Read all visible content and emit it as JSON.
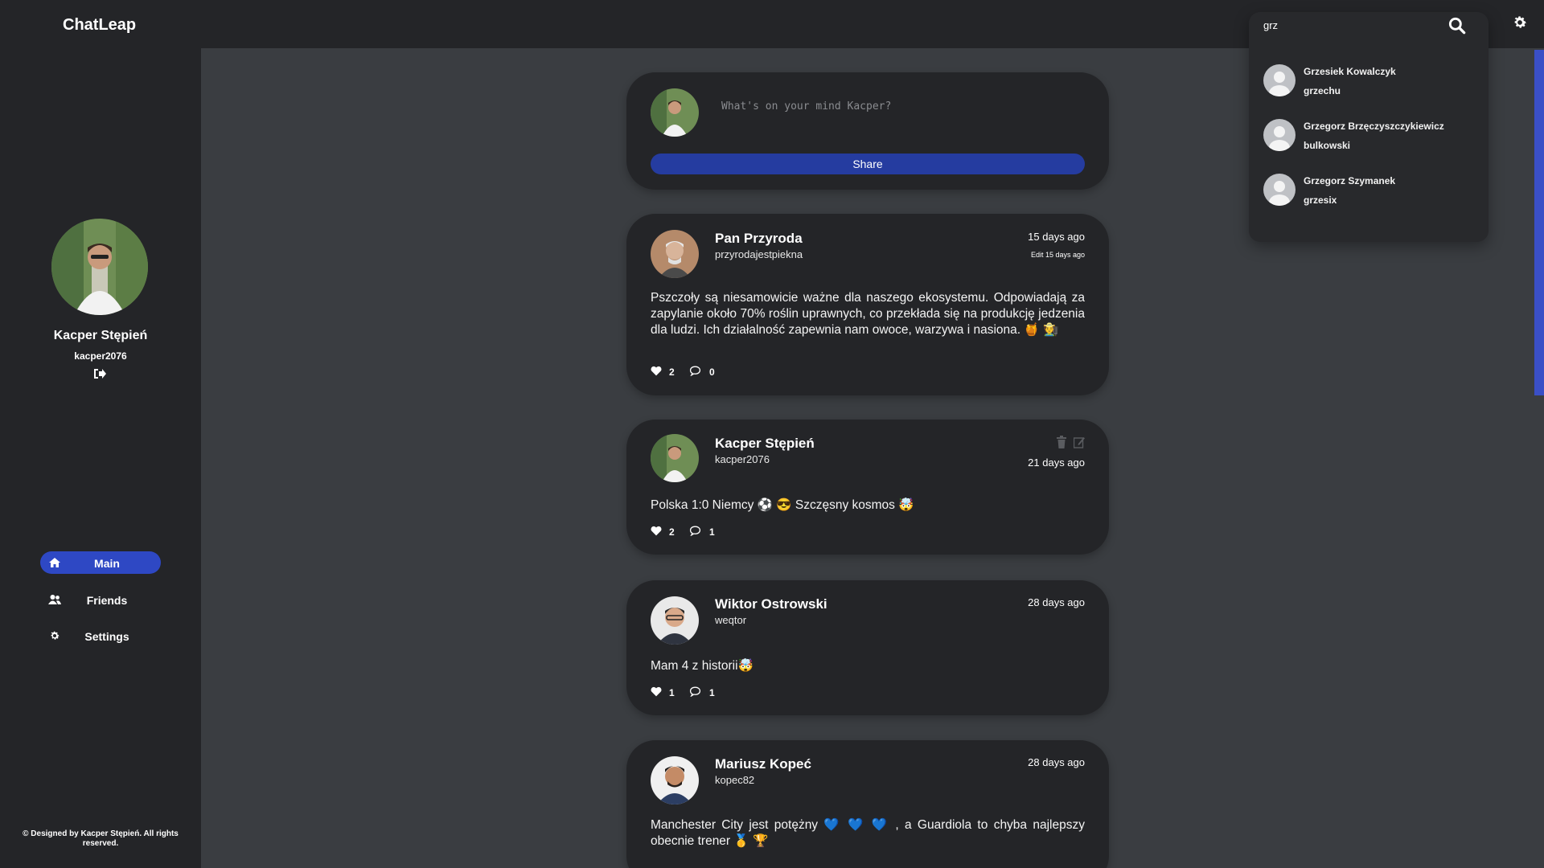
{
  "app": {
    "name": "ChatLeap"
  },
  "search": {
    "value": "grz"
  },
  "search_results": [
    {
      "name": "Grzesiek Kowalczyk",
      "handle": "grzechu"
    },
    {
      "name": "Grzegorz Brzęczyszczykiewicz",
      "handle": "bulkowski"
    },
    {
      "name": "Grzegorz Szymanek",
      "handle": "grzesix"
    }
  ],
  "profile": {
    "name": "Kacper Stępień",
    "handle": "kacper2076"
  },
  "nav": [
    {
      "label": "Main",
      "icon": "home-icon",
      "active": true
    },
    {
      "label": "Friends",
      "icon": "users-icon",
      "active": false
    },
    {
      "label": "Settings",
      "icon": "gear-icon",
      "active": false
    }
  ],
  "footer": {
    "text": "© Designed by Kacper Stępień. All rights reserved."
  },
  "composer": {
    "placeholder": "What's on your mind Kacper?",
    "share_label": "Share"
  },
  "posts": [
    {
      "author": "Pan Przyroda",
      "handle": "przyrodajestpiekna",
      "time": "15 days ago",
      "edited": "Edit 15 days ago",
      "body": "Pszczoły są niesamowicie ważne dla naszego ekosystemu. Odpowiadają za zapylanie około 70% roślin uprawnych, co przekłada się na produkcję jedzenia dla ludzi. Ich działalność zapewnia nam owoce, warzywa i nasiona. 🍯 🧑‍🌾",
      "likes": "2",
      "comments": "0"
    },
    {
      "author": "Kacper Stępień",
      "handle": "kacper2076",
      "time": "21 days ago",
      "body": "Polska 1:0 Niemcy ⚽ 😎 Szczęsny kosmos 🤯",
      "likes": "2",
      "comments": "1"
    },
    {
      "author": "Wiktor Ostrowski",
      "handle": "weqtor",
      "time": "28 days ago",
      "body": "Mam 4 z historii🤯",
      "likes": "1",
      "comments": "1"
    },
    {
      "author": "Mariusz Kopeć",
      "handle": "kopec82",
      "time": "28 days ago",
      "body": "Manchester City jest potężny 💙 💙 💙 , a Guardiola to chyba najlepszy obecnie trener 🥇 🏆",
      "likes": "",
      "comments": ""
    }
  ]
}
